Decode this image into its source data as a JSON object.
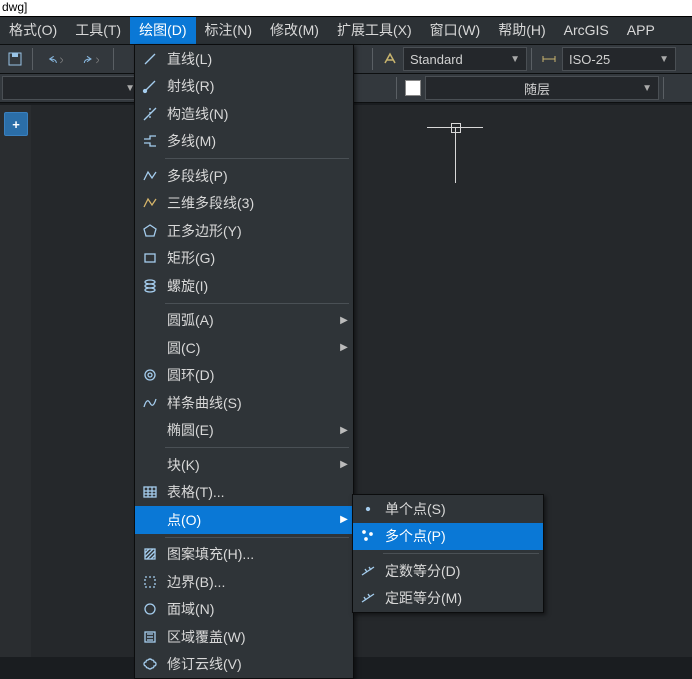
{
  "title_fragment": "dwg]",
  "menubar": [
    {
      "label": "格式(O)",
      "active": false
    },
    {
      "label": "工具(T)",
      "active": false
    },
    {
      "label": "绘图(D)",
      "active": true
    },
    {
      "label": "标注(N)",
      "active": false
    },
    {
      "label": "修改(M)",
      "active": false
    },
    {
      "label": "扩展工具(X)",
      "active": false
    },
    {
      "label": "窗口(W)",
      "active": false
    },
    {
      "label": "帮助(H)",
      "active": false
    },
    {
      "label": "ArcGIS",
      "active": false
    },
    {
      "label": "APP",
      "active": false
    }
  ],
  "toolbar1": {
    "textstyle": "Standard",
    "dimstyle": "ISO-25"
  },
  "toolbar2": {
    "layer_state": "随层"
  },
  "draw_menu": [
    {
      "icon": "line",
      "label": "直线(L)"
    },
    {
      "icon": "ray",
      "label": "射线(R)"
    },
    {
      "icon": "xline",
      "label": "构造线(N)"
    },
    {
      "icon": "mline",
      "label": "多线(M)"
    },
    {
      "sep": true
    },
    {
      "icon": "pline",
      "label": "多段线(P)"
    },
    {
      "icon": "3dpoly",
      "label": "三维多段线(3)"
    },
    {
      "icon": "polygon",
      "label": "正多边形(Y)"
    },
    {
      "icon": "rect",
      "label": "矩形(G)"
    },
    {
      "icon": "helix",
      "label": "螺旋(I)"
    },
    {
      "sep": true
    },
    {
      "icon": "",
      "label": "圆弧(A)",
      "submenu": true
    },
    {
      "icon": "",
      "label": "圆(C)",
      "submenu": true
    },
    {
      "icon": "donut",
      "label": "圆环(D)"
    },
    {
      "icon": "spline",
      "label": "样条曲线(S)"
    },
    {
      "icon": "",
      "label": "椭圆(E)",
      "submenu": true
    },
    {
      "sep": true
    },
    {
      "icon": "",
      "label": "块(K)",
      "submenu": true
    },
    {
      "icon": "table",
      "label": "表格(T)..."
    },
    {
      "icon": "",
      "label": "点(O)",
      "submenu": true,
      "highlight": true
    },
    {
      "sep": true
    },
    {
      "icon": "hatch",
      "label": "图案填充(H)..."
    },
    {
      "icon": "boundary",
      "label": "边界(B)..."
    },
    {
      "icon": "region",
      "label": "面域(N)"
    },
    {
      "icon": "wipeout",
      "label": "区域覆盖(W)"
    },
    {
      "icon": "revcloud",
      "label": "修订云线(V)"
    }
  ],
  "point_submenu": [
    {
      "icon": "point1",
      "label": "单个点(S)"
    },
    {
      "icon": "pointn",
      "label": "多个点(P)",
      "highlight": true
    },
    {
      "sep": true
    },
    {
      "icon": "divide",
      "label": "定数等分(D)"
    },
    {
      "icon": "measure",
      "label": "定距等分(M)"
    }
  ]
}
